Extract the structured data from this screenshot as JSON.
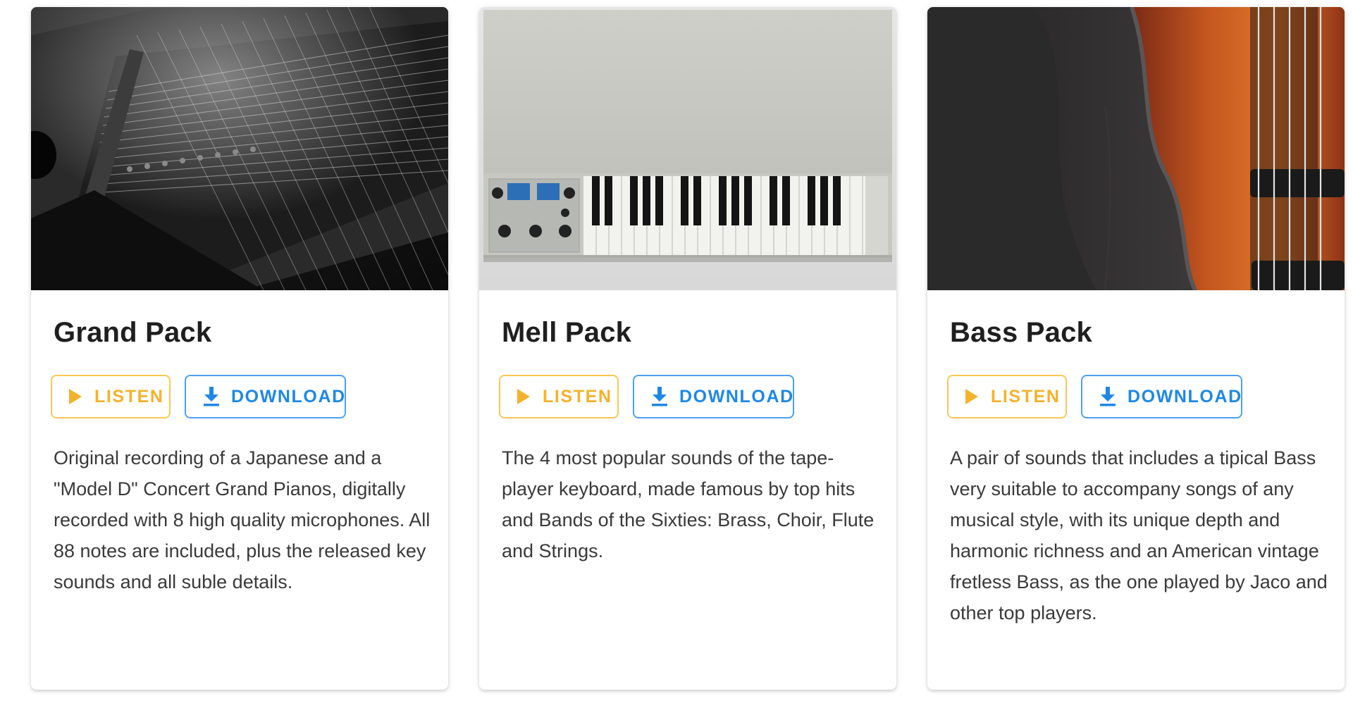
{
  "packs": [
    {
      "title": "Grand Pack",
      "listen_label": "LISTEN",
      "download_label": "DOWNLOAD",
      "description": "Original recording of a Japanese and a \"Model D\" Concert Grand Pianos, digitally recorded with 8 high quality microphones. All 88 notes are included, plus the released key sounds and all suble details.",
      "image": "grand-piano-strings-photo"
    },
    {
      "title": "Mell Pack",
      "listen_label": "LISTEN",
      "download_label": "DOWNLOAD",
      "description": "The 4 most popular sounds of the tape-player keyboard, made famous by top hits and Bands of the Sixties: Brass, Choir, Flute and Strings.",
      "image": "mellotron-keyboard-photo"
    },
    {
      "title": "Bass Pack",
      "listen_label": "LISTEN",
      "download_label": "DOWNLOAD",
      "description": "A pair of sounds that includes a tipical Bass very suitable to accompany songs of any musical style, with its unique depth and harmonic richness and an American vintage fretless Bass, as the one played by Jaco and other top players.",
      "image": "electric-bass-guitar-photo"
    }
  ],
  "colors": {
    "listen": "#f4b22c",
    "listen_border": "#f9c856",
    "download": "#1e88e5",
    "download_border": "#4f9ff2"
  },
  "icons": {
    "listen": "play-icon",
    "download": "download-icon"
  }
}
